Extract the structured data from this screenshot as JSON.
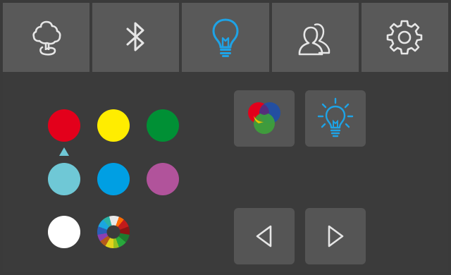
{
  "tabs": [
    {
      "icon": "tree-icon",
      "color": "#e6e6e6"
    },
    {
      "icon": "bluetooth-icon",
      "color": "#e6e6e6"
    },
    {
      "icon": "lightbulb-icon",
      "color": "#1ea3e6",
      "active": true
    },
    {
      "icon": "users-icon",
      "color": "#e6e6e6"
    },
    {
      "icon": "gear-icon",
      "color": "#e6e6e6"
    }
  ],
  "colors": {
    "red": "#e3001b",
    "yellow": "#ffed00",
    "green": "#009035",
    "cyan": "#6fc8d6",
    "blue": "#009fe3",
    "magenta": "#b1539b",
    "white": "#ffffff",
    "selected": "cyan"
  },
  "buttons": {
    "rgb_mix": {
      "icon": "rgb-mix-icon"
    },
    "bulb_rays": {
      "icon": "bulb-rays-icon",
      "color": "#1ea3e6"
    },
    "prev": {
      "icon": "triangle-left-icon"
    },
    "next": {
      "icon": "triangle-right-icon"
    }
  }
}
